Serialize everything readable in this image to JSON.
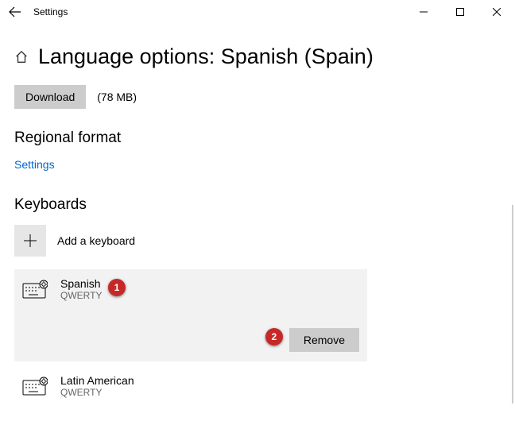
{
  "titlebar": {
    "app_title": "Settings"
  },
  "page": {
    "title": "Language options: Spanish (Spain)"
  },
  "download": {
    "button": "Download",
    "size": "(78 MB)"
  },
  "regional": {
    "heading": "Regional format",
    "link": "Settings"
  },
  "keyboards": {
    "heading": "Keyboards",
    "add_label": "Add a keyboard",
    "items": [
      {
        "name": "Spanish",
        "layout": "QWERTY",
        "remove": "Remove"
      },
      {
        "name": "Latin American",
        "layout": "QWERTY"
      }
    ]
  },
  "annotations": {
    "b1": "1",
    "b2": "2"
  }
}
